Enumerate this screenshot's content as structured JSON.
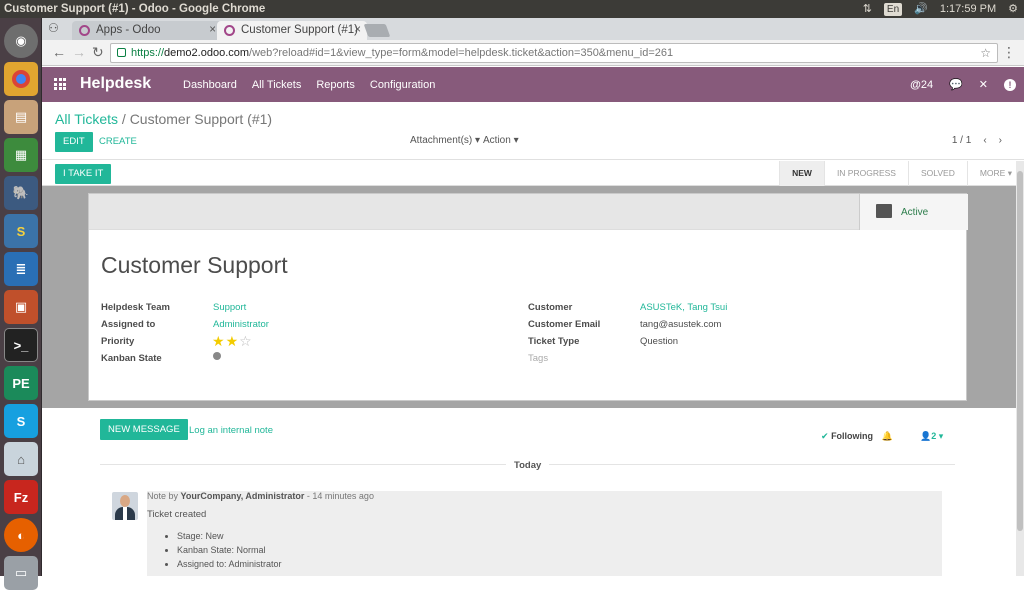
{
  "os": {
    "window_title": "Customer Support (#1) - Odoo - Google Chrome",
    "keyboard_layout": "En",
    "clock": "1:17:59 PM"
  },
  "browser": {
    "tabs": [
      {
        "label": "Apps - Odoo"
      },
      {
        "label": "Customer Support (#1)"
      }
    ],
    "url_scheme": "https://",
    "url_host": "demo2.odoo.com",
    "url_path": "/web?reload#id=1&view_type=form&model=helpdesk.ticket&action=350&menu_id=261"
  },
  "odoo_nav": {
    "app_name": "Helpdesk",
    "menu": [
      "Dashboard",
      "All Tickets",
      "Reports",
      "Configuration"
    ],
    "mentions_count": "24"
  },
  "control_panel": {
    "breadcrumb_parent": "All Tickets",
    "breadcrumb_sep": "/",
    "breadcrumb_current": "Customer Support (#1)",
    "edit_label": "EDIT",
    "create_label": "CREATE",
    "attachments_label": "Attachment(s)",
    "action_label": "Action",
    "pager": "1 / 1"
  },
  "statusbar": {
    "take_label": "I TAKE IT",
    "stages": [
      "NEW",
      "IN PROGRESS",
      "SOLVED",
      "MORE"
    ],
    "current_stage": "NEW"
  },
  "form": {
    "archive_label": "Active",
    "title": "Customer Support",
    "left_fields": [
      {
        "label": "Helpdesk Team",
        "value": "Support"
      },
      {
        "label": "Assigned to",
        "value": "Administrator"
      },
      {
        "label": "Priority",
        "value": ""
      },
      {
        "label": "Kanban State",
        "value": ""
      }
    ],
    "priority_stars": 2,
    "priority_max": 3,
    "right_fields": [
      {
        "label": "Customer",
        "value": "ASUSTeK, Tang Tsui"
      },
      {
        "label": "Customer Email",
        "value": "tang@asustek.com"
      },
      {
        "label": "Ticket Type",
        "value": "Question"
      }
    ],
    "tags_placeholder": "Tags"
  },
  "chatter": {
    "new_message_label": "NEW MESSAGE",
    "log_note_label": "Log an internal note",
    "following_label": "Following",
    "followers_count": "2",
    "day_label": "Today",
    "message": {
      "prefix": "Note by",
      "author": "YourCompany, Administrator",
      "time": "- 14 minutes ago",
      "body": "Ticket created",
      "changes": [
        "Stage: New",
        "Kanban State: Normal",
        "Assigned to: Administrator"
      ]
    }
  },
  "colors": {
    "odoo_purple": "#875a7b",
    "odoo_teal": "#21b799"
  }
}
